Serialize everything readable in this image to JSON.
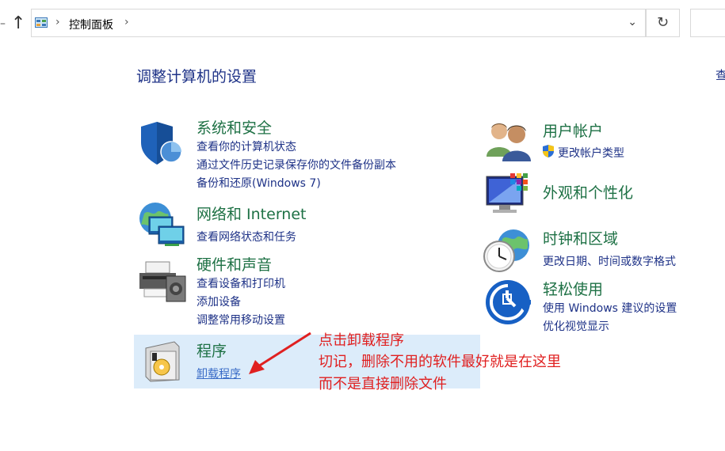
{
  "address_bar": {
    "breadcrumb": "控制面板"
  },
  "main": {
    "title": "调整计算机的设置",
    "view_by_partial": "查"
  },
  "categories": {
    "system_security": {
      "title": "系统和安全",
      "links": [
        "查看你的计算机状态",
        "通过文件历史记录保存你的文件备份副本",
        "备份和还原(Windows 7)"
      ]
    },
    "network": {
      "title": "网络和 Internet",
      "links": [
        "查看网络状态和任务"
      ]
    },
    "hardware": {
      "title": "硬件和声音",
      "links": [
        "查看设备和打印机",
        "添加设备",
        "调整常用移动设置"
      ]
    },
    "programs": {
      "title": "程序",
      "links": [
        "卸载程序"
      ]
    },
    "user_accounts": {
      "title": "用户帐户",
      "links": [
        "更改帐户类型"
      ]
    },
    "appearance": {
      "title": "外观和个性化"
    },
    "clock_region": {
      "title": "时钟和区域",
      "links": [
        "更改日期、时间或数字格式"
      ]
    },
    "ease_of_access": {
      "title": "轻松使用",
      "links": [
        "使用 Windows 建议的设置",
        "优化视觉显示"
      ]
    }
  },
  "annotation": {
    "lines": [
      "点击卸载程序",
      "切记，删除不用的软件最好就是在这里",
      "而不是直接删除文件"
    ],
    "color": "#e02020"
  },
  "colors": {
    "category_title": "#1e7145",
    "link": "#1e3287",
    "highlight": "#dcecfa"
  }
}
